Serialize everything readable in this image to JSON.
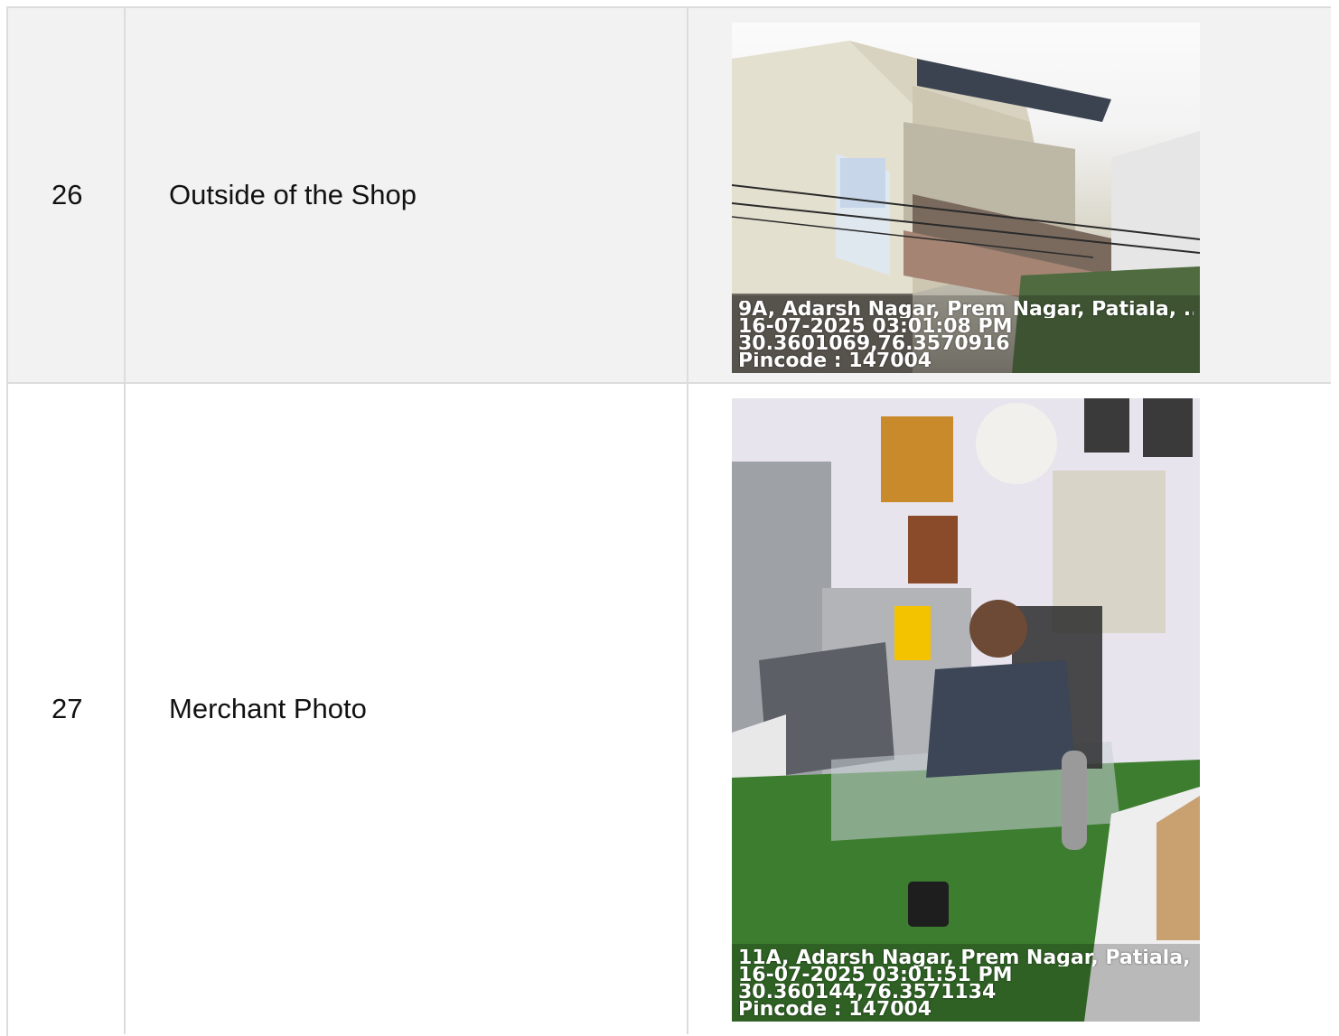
{
  "rows": [
    {
      "no": "26",
      "label": "Outside of the Shop",
      "photo": {
        "address": "9A, Adarsh Nagar, Prem Nagar, Patiala, ...",
        "datetime": "16-07-2025 03:01:08 PM",
        "coords": "30.3601069,76.3570916",
        "pincode": "Pincode : 147004"
      }
    },
    {
      "no": "27",
      "label": "Merchant Photo",
      "photo": {
        "address": "11A, Adarsh Nagar, Prem Nagar, Patiala, ...",
        "datetime": "16-07-2025 03:01:51 PM",
        "coords": "30.360144,76.3571134",
        "pincode": "Pincode : 147004"
      }
    }
  ]
}
